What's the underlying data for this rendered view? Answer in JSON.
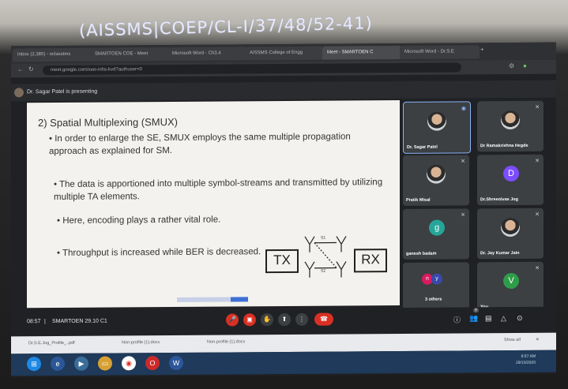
{
  "caption": "(AISSMS|COEP/CL-I/37/48/52-41)",
  "browser": {
    "tabs": [
      {
        "label": "Inbox (2,385) - nclasstms",
        "active": false
      },
      {
        "label": "SMARTOEN COE - Meet",
        "active": false
      },
      {
        "label": "Microsoft Word - Ch3.4",
        "active": false
      },
      {
        "label": "AISSMS College of Engg",
        "active": false
      },
      {
        "label": "Meet - SMARTOEN C",
        "active": true
      },
      {
        "label": "Microsoft Word - Dr.S.E",
        "active": false
      }
    ],
    "url": "meet.google.com/xws-inhs-kvd?authuser=0"
  },
  "meet": {
    "presenting_label": "Dr. Sagar Patel is presenting",
    "meeting_time": "08:57",
    "meeting_name": "SMARTOEN 29.10 C1",
    "participant_count": "9"
  },
  "slide": {
    "title": "2) Spatial Multiplexing (SMUX)",
    "bullets": [
      "• In order to enlarge the SE, SMUX employs the same multiple propagation approach as explained for SM.",
      "• The data is apportioned into multiple symbol-streams and transmitted by utilizing multiple TA elements.",
      "• Here, encoding plays a rather vital role.",
      "• Throughput is increased while BER is decreased."
    ],
    "diagram": {
      "tx": "TX",
      "rx": "RX",
      "s1": "S1",
      "s2": "S2"
    }
  },
  "participants": [
    {
      "name": "Dr. Sagar Patel",
      "type": "photo",
      "selected": true
    },
    {
      "name": "Dr Ramakrishna Hegde",
      "type": "photo"
    },
    {
      "name": "Pratik Misal",
      "type": "photo"
    },
    {
      "name": "Dr.Shreenivas Jog",
      "type": "initial",
      "initial": "D",
      "color": "#7c4dff"
    },
    {
      "name": "ganesh badam",
      "type": "initial",
      "initial": "g",
      "color": "#26a69a"
    },
    {
      "name": "Dr. Jay Kumar Jain",
      "type": "photo"
    },
    {
      "name": "3 others",
      "type": "group"
    },
    {
      "name": "You",
      "type": "initial",
      "initial": "V",
      "color": "#2e9d4a"
    }
  ],
  "downloads": [
    "Dr.S.E.Jog_Profile_..pdf",
    "Non-profile (1).docx",
    "Non-profile (1).docx"
  ],
  "downloads_show_all": "Show all",
  "tray_time": "8:57 AM",
  "tray_date": "29/10/2020",
  "colors": {
    "end_call": "#d93025",
    "meet_bg": "#202124",
    "slide_bg": "#f3f2ee",
    "accent": "#8ab4f8"
  }
}
